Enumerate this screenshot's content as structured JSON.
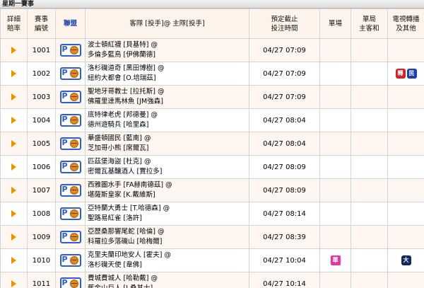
{
  "page_title": "星期一賽事",
  "headers": {
    "details": "詳細\n賠率",
    "game_no": "賽事\n編號",
    "league": "聯盟",
    "matchup": "客隊 [投手]@ 主隊[投手]",
    "cutoff": "預定截止\n投注時間",
    "single": "單場",
    "single_home_away": "單局\n主客和",
    "tv": "電視轉播\n及其他"
  },
  "games": [
    {
      "no": "1001",
      "away": "波士頓紅襪 [貝基特]",
      "home": "多倫多藍鳥 [伊佛蘭德]",
      "time": "04/27 07:09",
      "single_mark": "",
      "tv": []
    },
    {
      "no": "1002",
      "away": "洛杉磯道奇 [黑田博樹]",
      "home": "紐約大都會 [O.培瑞茲]",
      "time": "04/27 07:09",
      "single_mark": "",
      "tv": [
        "轉",
        "民"
      ]
    },
    {
      "no": "1003",
      "away": "聖地牙哥教士 [拉托斯]",
      "home": "佛羅里達馬林魚 [JM強森]",
      "time": "04/27 07:09",
      "single_mark": "",
      "tv": []
    },
    {
      "no": "1004",
      "away": "底特律老虎 [邦德曼]",
      "home": "德州遊騎兵 [哈里森]",
      "time": "04/27 08:04",
      "single_mark": "",
      "tv": []
    },
    {
      "no": "1005",
      "away": "華盛頓國民 [藍南]",
      "home": "芝加哥小熊 [席爾瓦]",
      "time": "04/27 08:04",
      "single_mark": "",
      "tv": []
    },
    {
      "no": "1006",
      "away": "匹茲堡海盜 [杜克]",
      "home": "密爾瓦基釀酒人 [賈拉多]",
      "time": "04/27 08:09",
      "single_mark": "",
      "tv": []
    },
    {
      "no": "1007",
      "away": "西雅圖水手 [FA赫南德茲]",
      "home": "堪薩斯皇家 [K.戴維斯]",
      "time": "04/27 08:09",
      "single_mark": "",
      "tv": []
    },
    {
      "no": "1008",
      "away": "亞特蘭大勇士 [T.哈德森]",
      "home": "聖路易紅雀 [洛許]",
      "time": "04/27 08:14",
      "single_mark": "",
      "tv": []
    },
    {
      "no": "1009",
      "away": "亞歷桑那響尾蛇 [哈倫]",
      "home": "科羅拉多落磯山 [哈梅爾]",
      "time": "04/27 08:39",
      "single_mark": "",
      "tv": []
    },
    {
      "no": "1010",
      "away": "克里夫蘭印地安人 [霍夫]",
      "home": "洛杉磯天使 [韋佛]",
      "time": "04/27 10:04",
      "single_mark": "單",
      "tv": [
        "大"
      ]
    },
    {
      "no": "1011",
      "away": "費城費城人 [哈勒戴]",
      "home": "舊金山巨人 [J.桑其士]",
      "time": "04/27 10:14",
      "single_mark": "",
      "tv": []
    }
  ],
  "at_symbol": "@",
  "colors": {
    "header_bg": "#fff4ec",
    "arrow": "#e69400",
    "league_blue": "#2f5bd4"
  }
}
